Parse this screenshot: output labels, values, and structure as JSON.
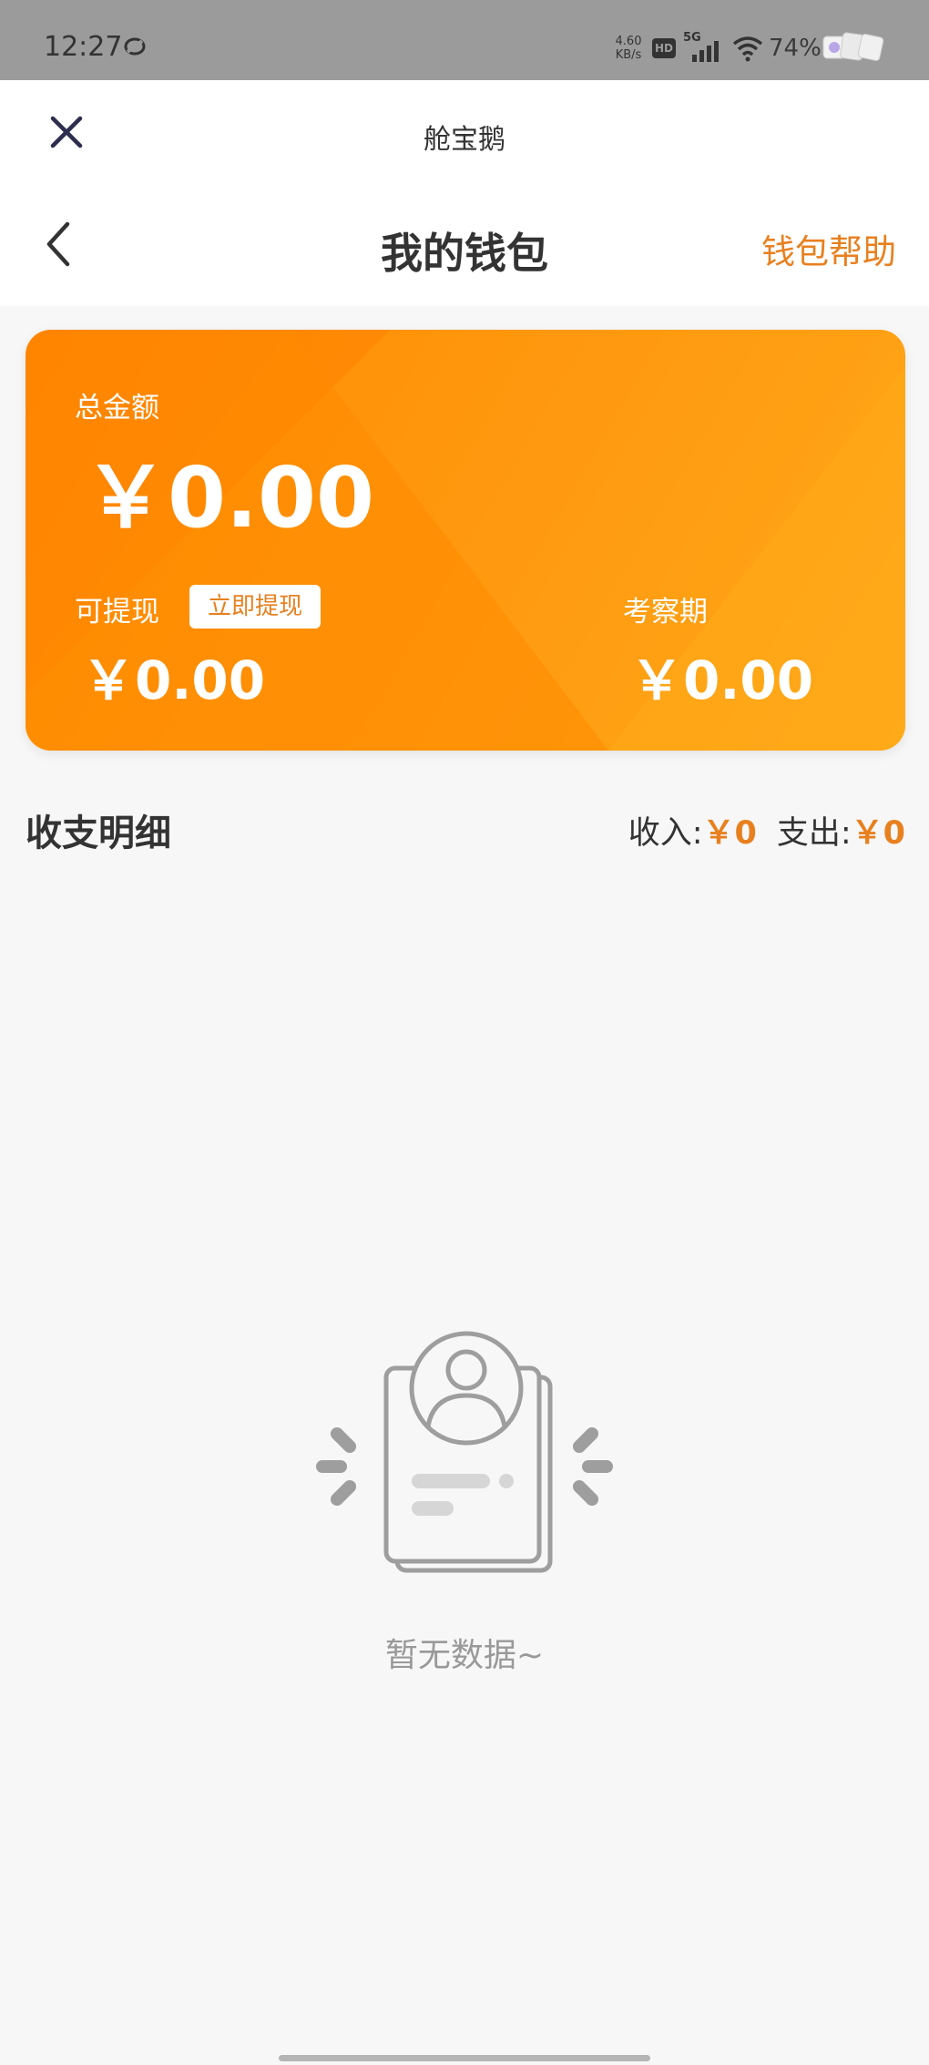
{
  "status_bar": {
    "time": "12:27",
    "net_speed_value": "4.60",
    "net_speed_unit": "KB/s",
    "hd": "HD",
    "network": "5G",
    "battery": "74%"
  },
  "mini_program": {
    "title": "舱宝鹅"
  },
  "nav": {
    "title": "我的钱包",
    "help": "钱包帮助"
  },
  "wallet": {
    "total_label": "总金额",
    "total_amount": "￥0.00",
    "withdrawable_label": "可提现",
    "withdraw_button": "立即提现",
    "withdrawable_amount": "￥0.00",
    "review_label": "考察期",
    "review_amount": "￥0.00"
  },
  "details": {
    "title": "收支明细",
    "income_label": "收入:",
    "income_value": "￥0",
    "expense_label": "支出:",
    "expense_value": "￥0"
  },
  "empty": {
    "text": "暂无数据~"
  },
  "colors": {
    "accent": "#e8801f",
    "card_start": "#ff8a00",
    "card_end": "#ffa818",
    "page_bg": "#f7f7f7"
  }
}
